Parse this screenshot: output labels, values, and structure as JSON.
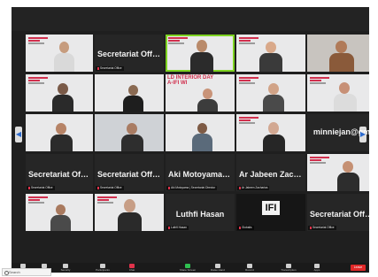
{
  "meeting": {
    "tiles": {
      "r1c1": {
        "label": "Secretariat Office"
      },
      "r1c2": {
        "name": "Secretariat Office",
        "label": "Secretariat Office"
      },
      "r1c3": {
        "label": ""
      },
      "r1c4": {
        "label": ""
      },
      "r1c5": {
        "label": ""
      },
      "r2c1": {
        "label": ""
      },
      "r2c2": {
        "label": ""
      },
      "r2c3": {
        "banner": "LD INTERIOR DAY\nA-IFI WI",
        "label": ""
      },
      "r2c4": {
        "label": ""
      },
      "r2c5": {
        "label": ""
      },
      "r3c1": {
        "label": ""
      },
      "r3c2": {
        "label": ""
      },
      "r3c3": {
        "label": ""
      },
      "r3c4": {
        "label": ""
      },
      "r3c5": {
        "name": "minniejan@gm",
        "label": ""
      },
      "r4c1": {
        "name": "Secretariat Office",
        "label": "Secretariat Office"
      },
      "r4c2": {
        "name": "Secretariat Office",
        "label": "Secretariat Office"
      },
      "r4c3": {
        "name": "Aki Motoyama |...",
        "label": "Aki Motoyama | Secretariat Director"
      },
      "r4c4": {
        "name": "Ar Jabeen Zach...",
        "label": "Ar Jabeen Zacharias"
      },
      "r4c5": {
        "label": ""
      },
      "r5c1": {
        "label": ""
      },
      "r5c2": {
        "label": ""
      },
      "r5c3": {
        "name": "Luthfi Hasan",
        "label": "Luthfi Hasan"
      },
      "r5c4": {
        "logo": "IFI",
        "label": "Globalis"
      },
      "r5c5": {
        "name": "Secretariat Office",
        "label": "Secretariat Office"
      }
    },
    "nav": {
      "left": "◀",
      "right": "▶"
    }
  },
  "toolbar": {
    "items": [
      {
        "label": "Mute",
        "icon": "microphone-icon"
      },
      {
        "label": "Start Video",
        "icon": "video-camera-icon"
      },
      {
        "label": "Security",
        "icon": "shield-icon"
      },
      {
        "label": "Participants",
        "icon": "participants-icon"
      },
      {
        "label": "Chat",
        "icon": "chat-icon"
      },
      {
        "label": "Share Screen",
        "icon": "share-screen-icon"
      },
      {
        "label": "Raise Hand",
        "icon": "raise-hand-icon"
      },
      {
        "label": "Record",
        "icon": "record-icon"
      },
      {
        "label": "Transcription",
        "icon": "transcription-icon"
      },
      {
        "label": "Apps",
        "icon": "apps-icon"
      }
    ],
    "end_label": "Leave"
  },
  "taskbar": {
    "search_placeholder": "Search"
  },
  "colors": {
    "accent_red": "#e02828",
    "speaker_green": "#7ed321",
    "brand_pink": "#d1304e"
  }
}
